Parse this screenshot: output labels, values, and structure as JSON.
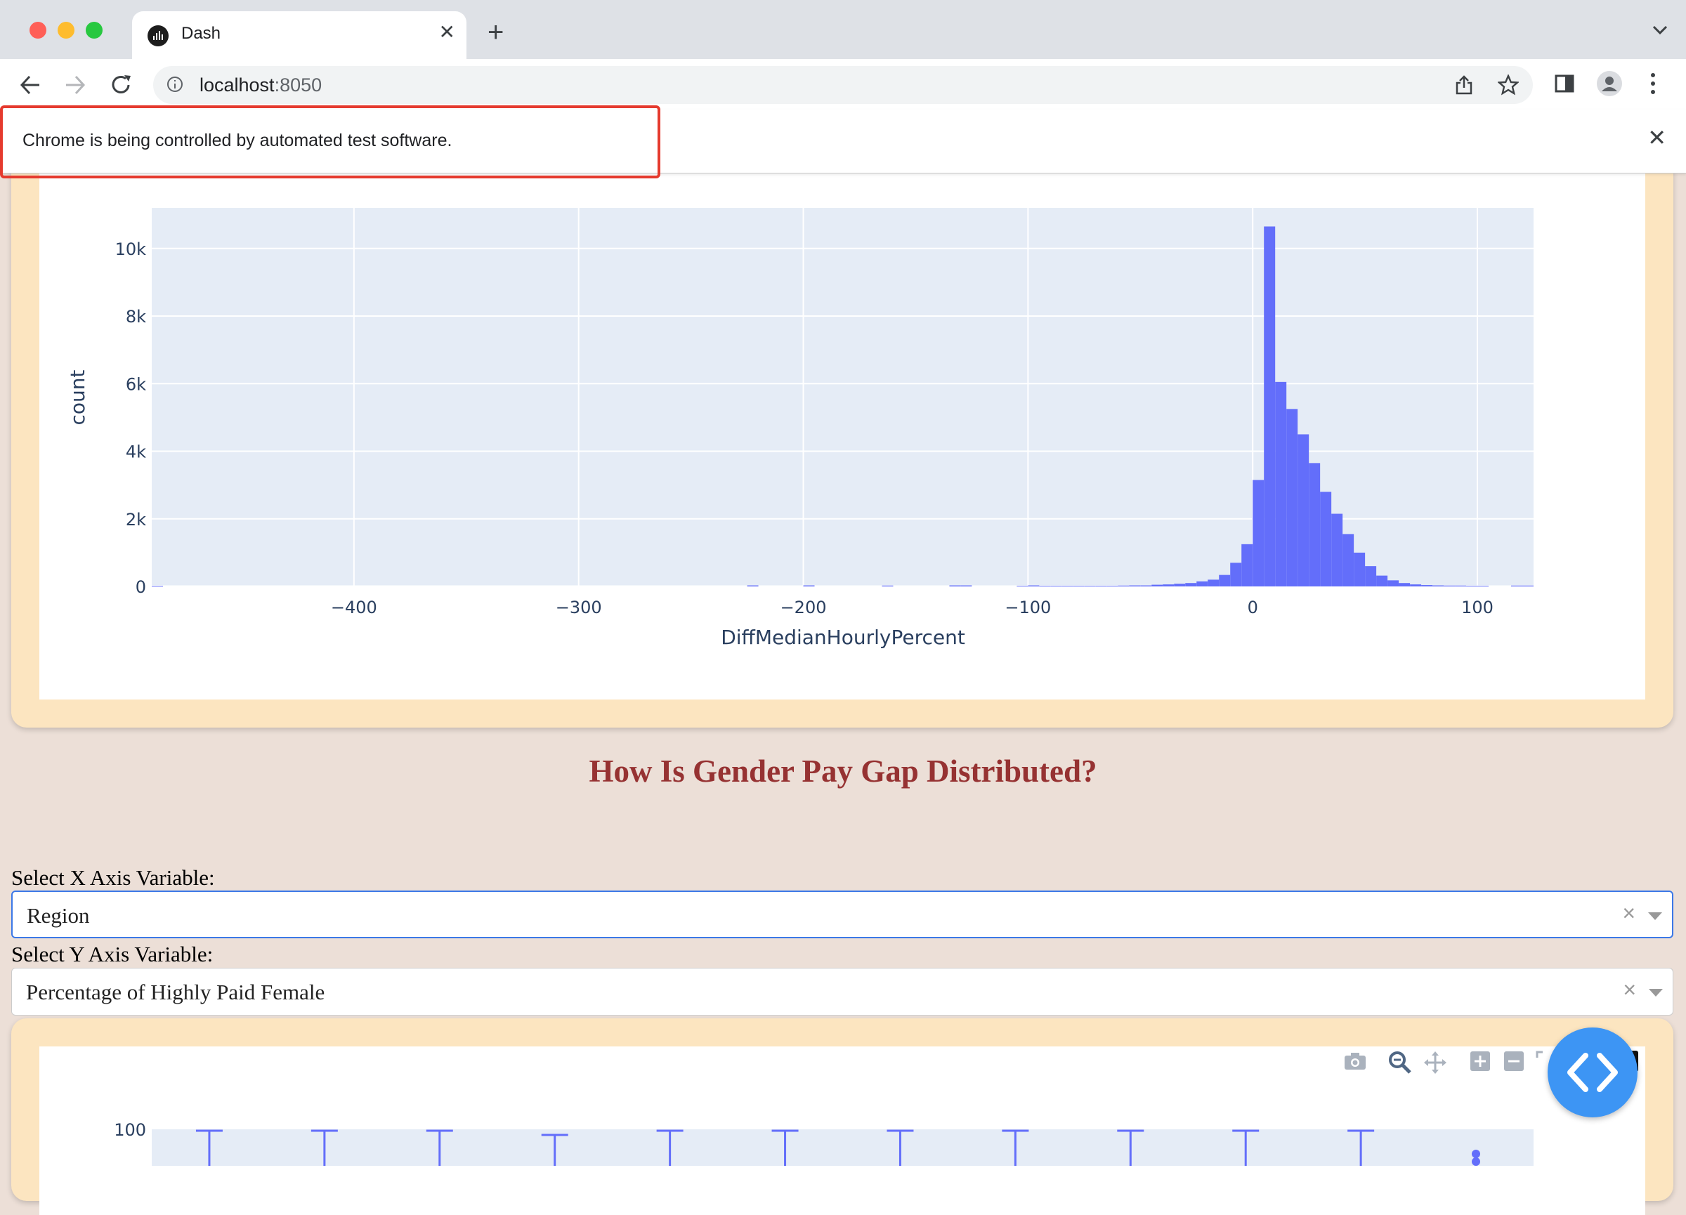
{
  "browser": {
    "tab_title": "Dash",
    "url_host": "localhost",
    "url_port": ":8050",
    "infobar_message": "Chrome is being controlled by automated test software.",
    "traffic_colors": {
      "close": "#ff5f57",
      "minimize": "#febc2e",
      "maximize": "#28c840"
    }
  },
  "histogram": {
    "chart_data": {
      "type": "bar",
      "xlabel": "DiffMedianHourlyPercent",
      "ylabel": "count",
      "x_ticks": [
        "−400",
        "−300",
        "−200",
        "−100",
        "0",
        "100"
      ],
      "x_tick_values": [
        -400,
        -300,
        -200,
        -100,
        0,
        100
      ],
      "y_ticks": [
        "0",
        "2k",
        "4k",
        "6k",
        "8k",
        "10k"
      ],
      "y_tick_values": [
        0,
        2000,
        4000,
        6000,
        8000,
        10000
      ],
      "xlim": [
        -490,
        125
      ],
      "ylim": [
        0,
        11200
      ],
      "bin_width": 5,
      "bins": [
        {
          "x": -490,
          "count": 15
        },
        {
          "x": -225,
          "count": 30
        },
        {
          "x": -200,
          "count": 30
        },
        {
          "x": -165,
          "count": 25
        },
        {
          "x": -135,
          "count": 30
        },
        {
          "x": -130,
          "count": 30
        },
        {
          "x": -105,
          "count": 20
        },
        {
          "x": -100,
          "count": 30
        },
        {
          "x": -95,
          "count": 20
        },
        {
          "x": -90,
          "count": 20
        },
        {
          "x": -85,
          "count": 20
        },
        {
          "x": -80,
          "count": 20
        },
        {
          "x": -75,
          "count": 20
        },
        {
          "x": -70,
          "count": 20
        },
        {
          "x": -65,
          "count": 20
        },
        {
          "x": -60,
          "count": 25
        },
        {
          "x": -55,
          "count": 30
        },
        {
          "x": -50,
          "count": 30
        },
        {
          "x": -45,
          "count": 50
        },
        {
          "x": -40,
          "count": 60
        },
        {
          "x": -35,
          "count": 80
        },
        {
          "x": -30,
          "count": 100
        },
        {
          "x": -25,
          "count": 150
        },
        {
          "x": -20,
          "count": 200
        },
        {
          "x": -15,
          "count": 340
        },
        {
          "x": -10,
          "count": 700
        },
        {
          "x": -5,
          "count": 1250
        },
        {
          "x": 0,
          "count": 3150
        },
        {
          "x": 5,
          "count": 10650
        },
        {
          "x": 10,
          "count": 6050
        },
        {
          "x": 15,
          "count": 5250
        },
        {
          "x": 20,
          "count": 4500
        },
        {
          "x": 25,
          "count": 3650
        },
        {
          "x": 30,
          "count": 2800
        },
        {
          "x": 35,
          "count": 2150
        },
        {
          "x": 40,
          "count": 1550
        },
        {
          "x": 45,
          "count": 1000
        },
        {
          "x": 50,
          "count": 600
        },
        {
          "x": 55,
          "count": 320
        },
        {
          "x": 60,
          "count": 180
        },
        {
          "x": 65,
          "count": 100
        },
        {
          "x": 70,
          "count": 60
        },
        {
          "x": 75,
          "count": 40
        },
        {
          "x": 80,
          "count": 30
        },
        {
          "x": 85,
          "count": 25
        },
        {
          "x": 90,
          "count": 25
        },
        {
          "x": 95,
          "count": 20
        },
        {
          "x": 100,
          "count": 20
        },
        {
          "x": 115,
          "count": 25
        },
        {
          "x": 120,
          "count": 25
        }
      ],
      "bar_color": "#636efa",
      "plot_bg": "#e5ecf6",
      "grid": true
    }
  },
  "section": {
    "heading": "How Is Gender Pay Gap Distributed?",
    "x_label": "Select X Axis Variable:",
    "x_value": "Region",
    "y_label": "Select Y Axis Variable:",
    "y_value": "Percentage of Highly Paid Female",
    "clear_glyph": "×"
  },
  "boxplot": {
    "chart_data": {
      "type": "box",
      "y_ticks": [
        "100"
      ],
      "y_tick_values": [
        100
      ],
      "visible_whisker_caps": 11,
      "color": "#636efa"
    }
  }
}
